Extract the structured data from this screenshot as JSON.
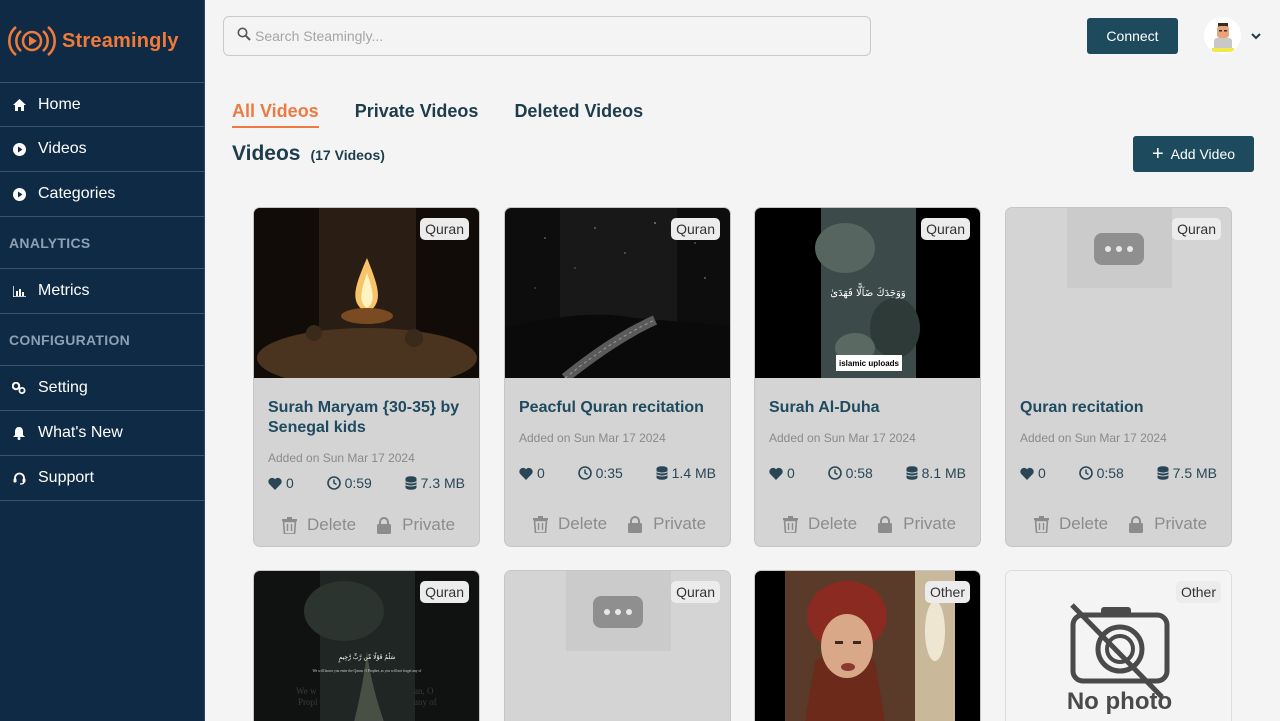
{
  "brand": {
    "name": "Streamingly",
    "color": "#f07a3a"
  },
  "sidebar": {
    "items": [
      {
        "label": "Home",
        "icon": "home-icon"
      },
      {
        "label": "Videos",
        "icon": "play-circle-icon"
      },
      {
        "label": "Categories",
        "icon": "play-circle-icon"
      }
    ],
    "section_analytics": "ANALYTICS",
    "analytics_items": [
      {
        "label": "Metrics",
        "icon": "bar-chart-icon"
      }
    ],
    "section_configuration": "CONFIGURATION",
    "config_items": [
      {
        "label": "Setting",
        "icon": "gears-icon"
      },
      {
        "label": "What's New",
        "icon": "bell-icon"
      },
      {
        "label": "Support",
        "icon": "headset-icon"
      }
    ]
  },
  "search": {
    "placeholder": "Search Steamingly...",
    "value": ""
  },
  "header": {
    "connect_label": "Connect"
  },
  "tabs": [
    {
      "label": "All Videos",
      "active": true
    },
    {
      "label": "Private Videos",
      "active": false
    },
    {
      "label": "Deleted Videos",
      "active": false
    }
  ],
  "main": {
    "title": "Videos",
    "count": "(17 Videos)",
    "add_label": "Add Video"
  },
  "cards": [
    {
      "tag": "Quran",
      "title": "Surah Maryam {30-35} by Senegal kids",
      "added": "Added on Sun Mar 17 2024",
      "likes": "0",
      "duration": "0:59",
      "size": "7.3 MB",
      "delete": "Delete",
      "private": "Private",
      "thumb": "campfire"
    },
    {
      "tag": "Quran",
      "title": "Peacful Quran recitation",
      "added": "Added on Sun Mar 17 2024",
      "likes": "0",
      "duration": "0:35",
      "size": "1.4 MB",
      "delete": "Delete",
      "private": "Private",
      "thumb": "night-road"
    },
    {
      "tag": "Quran",
      "title": "Surah Al-Duha",
      "added": "Added on Sun Mar 17 2024",
      "likes": "0",
      "duration": "0:58",
      "size": "8.1 MB",
      "delete": "Delete",
      "private": "Private",
      "thumb": "calligraphy",
      "thumb_text": "islamic uploads",
      "thumb_arabic": "وَوَجَدَكَ ضَآلًّا فَهَدَىٰ"
    },
    {
      "tag": "Quran",
      "title": "Quran recitation",
      "added": "Added on Sun Mar 17 2024",
      "likes": "0",
      "duration": "0:58",
      "size": "7.5 MB",
      "delete": "Delete",
      "private": "Private",
      "thumb": "loading"
    }
  ],
  "cards_row2": [
    {
      "tag": "Quran",
      "thumb": "forest-path",
      "thumb_arabic": "سَلَٰمٌ قَوْلًا مِّن رَّبٍّ رَّحِيمٍ",
      "thumb_caption": "We will honor you enter the Quran, O Prophet, as you will not forget any of",
      "thumb_big_left": "We w",
      "thumb_big_left2": "Propl",
      "thumb_big_right": "an, O",
      "thumb_big_right2": "any of"
    },
    {
      "tag": "Quran",
      "thumb": "loading"
    },
    {
      "tag": "Other",
      "thumb": "portrait"
    },
    {
      "tag": "Other",
      "thumb": "no-photo",
      "thumb_text": "No photo"
    }
  ]
}
